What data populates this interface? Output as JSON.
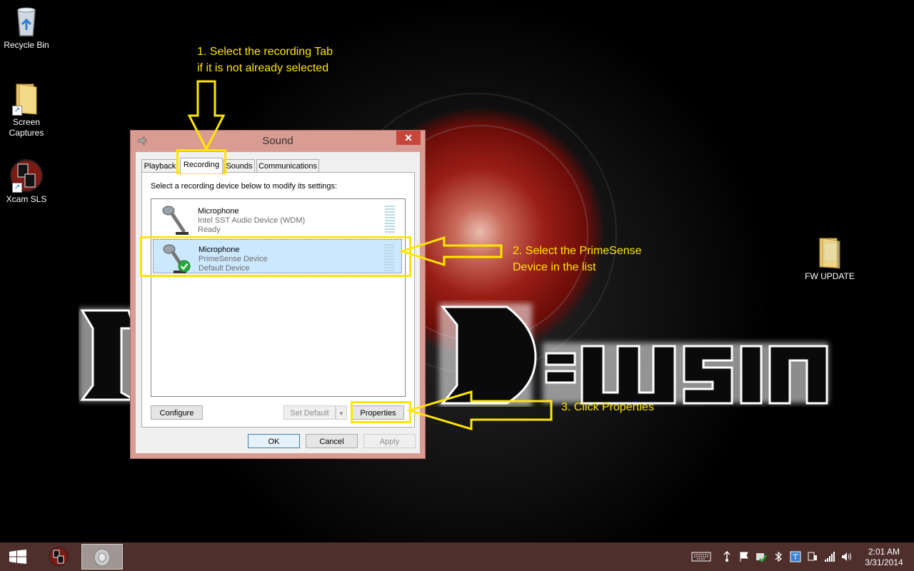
{
  "desktop": {
    "icons": [
      {
        "label": "Recycle Bin"
      },
      {
        "label": "Screen Captures"
      },
      {
        "label": "Xcam SLS"
      },
      {
        "label": "FW UPDATE"
      }
    ]
  },
  "dialog": {
    "title": "Sound",
    "close_label": "✕",
    "tabs": [
      {
        "label": "Playback"
      },
      {
        "label": "Recording"
      },
      {
        "label": "Sounds"
      },
      {
        "label": "Communications"
      }
    ],
    "instruction": "Select a recording device below to modify its settings:",
    "devices": [
      {
        "name": "Microphone",
        "driver": "Intel SST Audio Device (WDM)",
        "status": "Ready"
      },
      {
        "name": "Microphone",
        "driver": "PrimeSense Device",
        "status": "Default Device"
      }
    ],
    "buttons": {
      "configure": "Configure",
      "set_default": "Set Default",
      "properties": "Properties",
      "ok": "OK",
      "cancel": "Cancel",
      "apply": "Apply"
    }
  },
  "annotations": {
    "step1_line1": "1. Select the recording Tab",
    "step1_line2": "if it is not already selected",
    "step2_line1": "2. Select the PrimeSense",
    "step2_line2": "Device in the list",
    "step3": "3. Click Properties"
  },
  "taskbar": {
    "time": "2:01 AM",
    "date": "3/31/2014"
  },
  "colors": {
    "annotation": "#ffe600",
    "dialog_frame": "#d99c93",
    "taskbar": "#4e2f2c",
    "selection": "#cce8ff"
  }
}
